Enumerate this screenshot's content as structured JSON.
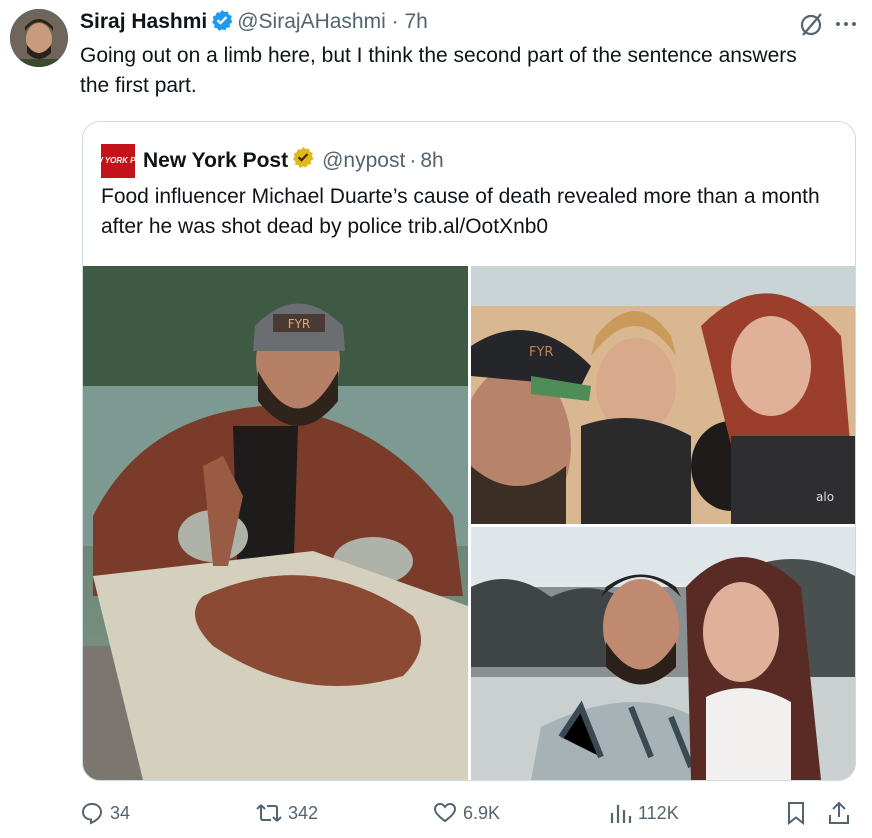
{
  "tweet": {
    "author_name": "Siraj Hashmi",
    "handle": "@SirajAHashmi",
    "time": "7h",
    "text": "Going out on a limb here, but I think the second part of the sentence answers the first part."
  },
  "quoted": {
    "logo_text": "NEW YORK POST",
    "author_name": "New York Post",
    "handle": "@nypost",
    "time": "8h",
    "text": "Food influencer Michael Duarte’s cause of death revealed more than a month after he was shot dead by police trib.al/OotXnb0",
    "cap_text": "FYR",
    "shirt_logo": "alo"
  },
  "actions": {
    "replies": "34",
    "reposts": "342",
    "likes": "6.9K",
    "views": "112K"
  },
  "colors": {
    "verified_blue": "#1d9bf0",
    "verified_gold": "#e2b719",
    "nypost_red": "#c4121a",
    "muted": "#536471"
  },
  "icons": [
    "grok-icon",
    "more-icon",
    "reply-icon",
    "repost-icon",
    "like-icon",
    "views-icon",
    "bookmark-icon",
    "share-icon"
  ]
}
